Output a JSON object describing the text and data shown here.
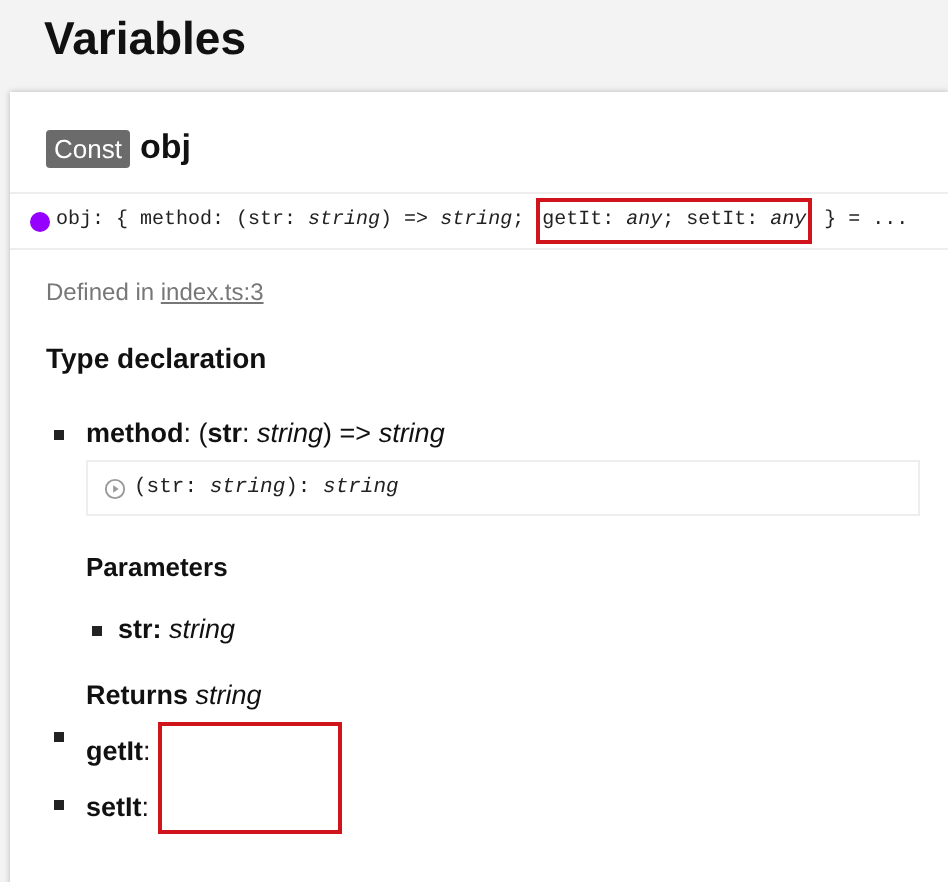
{
  "page_title": "Variables",
  "declaration": {
    "badge": "Const",
    "name": "obj",
    "signature": [
      {
        "text": "obj: { method: (str: *string*) => *string*; ",
        "highlighted": false
      },
      {
        "text": "getIt: *any*; setIt: *any*",
        "highlighted": true
      },
      {
        "text": " } = ...",
        "highlighted": false
      }
    ],
    "defined_in": "Defined in",
    "source_link": "index.ts:3",
    "type_declaration_heading": "Type declaration",
    "members": [
      {
        "kind": "method",
        "text": "**method**: (**str**: *string*) => *string*",
        "call_signature": "(str: *string*): *string*",
        "parameters_heading": "Parameters",
        "parameters": [
          "**str:** *string*"
        ],
        "returns": "**Returns** *string*"
      },
      {
        "kind": "property",
        "text": "**getIt**:",
        "highlighted": true
      },
      {
        "kind": "property",
        "text": "**setIt**:",
        "highlighted": true
      }
    ]
  }
}
